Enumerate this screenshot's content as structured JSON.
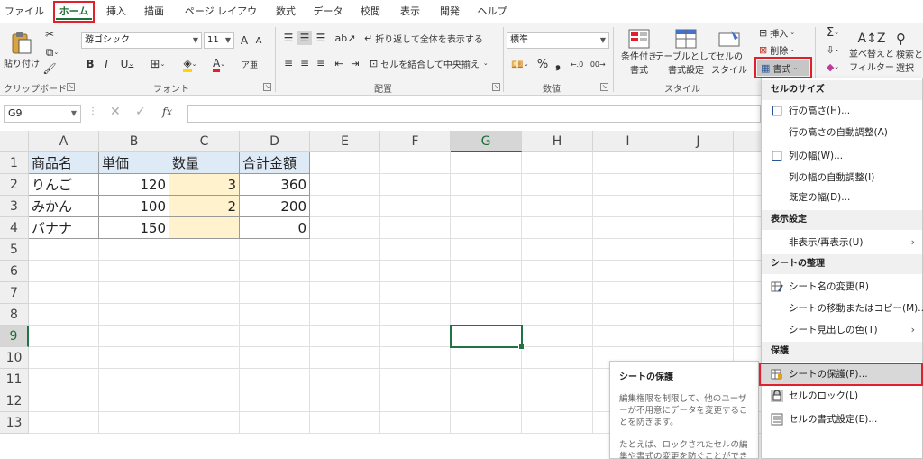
{
  "menu": {
    "tabs": [
      "ファイル",
      "ホーム",
      "挿入",
      "描画",
      "ページ レイアウト",
      "数式",
      "データ",
      "校閲",
      "表示",
      "開発",
      "ヘルプ"
    ],
    "active_index": 1
  },
  "ribbon": {
    "groups": {
      "clipboard": "クリップボード",
      "font": "フォント",
      "alignment": "配置",
      "number": "数値",
      "styles": "スタイル"
    },
    "paste_label": "貼り付け",
    "font_name": "游ゴシック",
    "font_size": "11",
    "wrap_text": "折り返して全体を表示する",
    "merge_center": "セルを結合して中央揃え",
    "number_format": "標準",
    "conditional_format": [
      "条件付き",
      "書式"
    ],
    "format_as_table": [
      "テーブルとして",
      "書式設定"
    ],
    "cell_styles": [
      "セルの",
      "スタイル"
    ],
    "insert": "挿入",
    "delete": "削除",
    "format": "書式",
    "sort_filter": [
      "並べ替えと",
      "フィルター"
    ],
    "find_select": [
      "検索と",
      "選択"
    ],
    "percent": "%",
    "comma": "❟"
  },
  "formula_bar": {
    "name_box": "G9",
    "fx": "fx"
  },
  "sheet": {
    "columns": [
      "A",
      "B",
      "C",
      "D",
      "E",
      "F",
      "G",
      "H",
      "I",
      "J"
    ],
    "rows": [
      "1",
      "2",
      "3",
      "4",
      "5",
      "6",
      "7",
      "8",
      "9",
      "10",
      "11",
      "12",
      "13"
    ],
    "selected_cell": "G9",
    "table": {
      "header": [
        "商品名",
        "単価",
        "数量",
        "合計金額"
      ],
      "body": [
        [
          "りんご",
          "120",
          "3",
          "360"
        ],
        [
          "みかん",
          "100",
          "2",
          "200"
        ],
        [
          "バナナ",
          "150",
          "",
          "0"
        ]
      ]
    },
    "colors": {
      "header_fill": "#deeaf6",
      "input_fill": "#fff2cc",
      "accent": "#217346"
    }
  },
  "dropdown": {
    "sections": [
      {
        "title": "セルのサイズ",
        "items": [
          {
            "label": "行の高さ(H)...",
            "icon": "row-height-icon"
          },
          {
            "label": "行の高さの自動調整(A)",
            "icon": ""
          },
          {
            "label": "列の幅(W)...",
            "icon": "column-width-icon"
          },
          {
            "label": "列の幅の自動調整(I)",
            "icon": ""
          },
          {
            "label": "既定の幅(D)...",
            "icon": ""
          }
        ]
      },
      {
        "title": "表示設定",
        "items": [
          {
            "label": "非表示/再表示(U)",
            "icon": "",
            "submenu": true
          }
        ]
      },
      {
        "title": "シートの整理",
        "items": [
          {
            "label": "シート名の変更(R)",
            "icon": "rename-sheet-icon"
          },
          {
            "label": "シートの移動またはコピー(M)...",
            "icon": ""
          },
          {
            "label": "シート見出しの色(T)",
            "icon": "",
            "submenu": true
          }
        ]
      },
      {
        "title": "保護",
        "items": [
          {
            "label": "シートの保護(P)...",
            "icon": "protect-sheet-icon",
            "highlighted": true
          },
          {
            "label": "セルのロック(L)",
            "icon": "lock-icon"
          },
          {
            "label": "セルの書式設定(E)...",
            "icon": "format-cells-icon"
          }
        ]
      }
    ]
  },
  "tooltip": {
    "title": "シートの保護",
    "body1": "編集権限を制限して、他のユーザーが不用意にデータを変更することを防ぎます。",
    "body2": "たとえば、ロックされたセルの編集や書式の変更を防ぐことができます。"
  }
}
